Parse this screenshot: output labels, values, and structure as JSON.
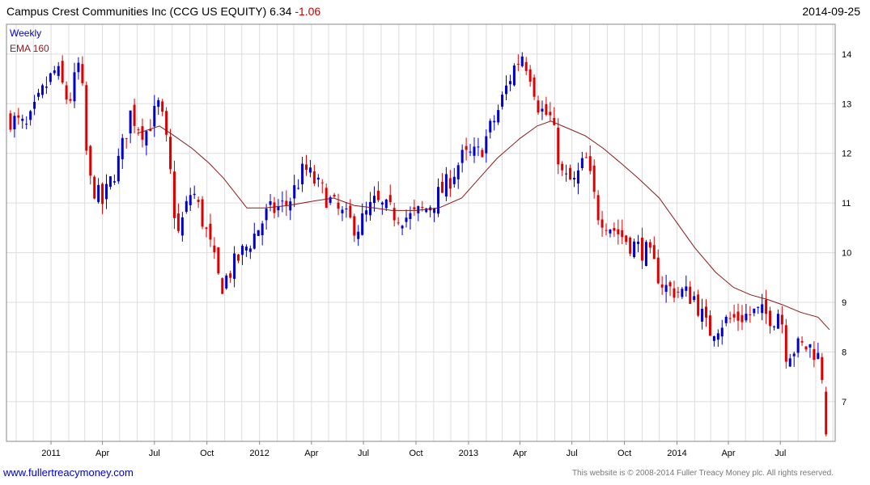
{
  "header": {
    "title": "Campus Crest Communities Inc (CCG US EQUITY) 6.34",
    "change": "-1.06",
    "date": "2014-09-25"
  },
  "footer": {
    "site": "www.fullertreacymoney.com",
    "copyright": "This website is © 2008-2014 Fuller Treacy Money plc. All rights reserved."
  },
  "chart_data": {
    "type": "candlestick",
    "title": "Campus Crest Communities Inc (CCG US EQUITY) 6.34 -1.06",
    "legend": [
      "Weekly",
      "EMA 160"
    ],
    "legend_position": "top-left",
    "y_axis_side": "right",
    "grid": true,
    "colors": {
      "up": "#0000cc",
      "down": "#dd0000",
      "ema": "#8b1a1a",
      "grid": "#dddddd"
    },
    "ylim": [
      6.2,
      14.6
    ],
    "yticks": [
      7,
      8,
      9,
      10,
      11,
      12,
      13,
      14
    ],
    "xticks": [
      {
        "label": "2011",
        "date": "2011-01-01"
      },
      {
        "label": "Apr",
        "date": "2011-04-01"
      },
      {
        "label": "Jul",
        "date": "2011-07-01"
      },
      {
        "label": "Oct",
        "date": "2011-10-01"
      },
      {
        "label": "2012",
        "date": "2012-01-01"
      },
      {
        "label": "Apr",
        "date": "2012-04-01"
      },
      {
        "label": "Jul",
        "date": "2012-07-01"
      },
      {
        "label": "Oct",
        "date": "2012-10-01"
      },
      {
        "label": "2013",
        "date": "2013-01-01"
      },
      {
        "label": "Apr",
        "date": "2013-04-01"
      },
      {
        "label": "Jul",
        "date": "2013-07-01"
      },
      {
        "label": "Oct",
        "date": "2013-10-01"
      },
      {
        "label": "2014",
        "date": "2014-01-01"
      },
      {
        "label": "Apr",
        "date": "2014-04-01"
      },
      {
        "label": "Jul",
        "date": "2014-07-01"
      }
    ],
    "xlim": [
      "2010-10-15",
      "2014-10-05"
    ],
    "close_path": [
      [
        "2010-10-22",
        12.7
      ],
      [
        "2010-11-20",
        12.5
      ],
      [
        "2010-12-20",
        13.3
      ],
      [
        "2011-01-10",
        13.7
      ],
      [
        "2011-02-01",
        13.0
      ],
      [
        "2011-02-21",
        13.9
      ],
      [
        "2011-03-07",
        11.5
      ],
      [
        "2011-04-01",
        11.0
      ],
      [
        "2011-05-01",
        11.9
      ],
      [
        "2011-05-20",
        12.8
      ],
      [
        "2011-06-15",
        12.4
      ],
      [
        "2011-07-10",
        13.0
      ],
      [
        "2011-07-25",
        12.0
      ],
      [
        "2011-08-10",
        10.3
      ],
      [
        "2011-09-05",
        11.3
      ],
      [
        "2011-10-03",
        10.3
      ],
      [
        "2011-10-25",
        9.3
      ],
      [
        "2011-11-20",
        9.8
      ],
      [
        "2011-12-20",
        10.3
      ],
      [
        "2012-01-15",
        10.8
      ],
      [
        "2012-02-20",
        11.0
      ],
      [
        "2012-03-20",
        11.7
      ],
      [
        "2012-04-15",
        11.3
      ],
      [
        "2012-05-20",
        10.8
      ],
      [
        "2012-06-20",
        10.5
      ],
      [
        "2012-07-20",
        11.0
      ],
      [
        "2012-08-20",
        10.8
      ],
      [
        "2012-09-20",
        10.7
      ],
      [
        "2012-10-20",
        10.9
      ],
      [
        "2012-11-20",
        11.3
      ],
      [
        "2012-12-20",
        11.9
      ],
      [
        "2013-01-20",
        12.0
      ],
      [
        "2013-02-20",
        12.8
      ],
      [
        "2013-03-20",
        13.7
      ],
      [
        "2013-04-05",
        14.0
      ],
      [
        "2013-04-20",
        13.6
      ],
      [
        "2013-05-05",
        12.9
      ],
      [
        "2013-05-25",
        12.7
      ],
      [
        "2013-06-15",
        11.5
      ],
      [
        "2013-07-05",
        11.4
      ],
      [
        "2013-07-25",
        11.9
      ],
      [
        "2013-08-15",
        10.8
      ],
      [
        "2013-09-10",
        10.5
      ],
      [
        "2013-10-10",
        10.2
      ],
      [
        "2013-11-10",
        10.0
      ],
      [
        "2013-12-10",
        9.3
      ],
      [
        "2014-01-10",
        9.2
      ],
      [
        "2014-02-01",
        9.1
      ],
      [
        "2014-02-25",
        8.4
      ],
      [
        "2014-03-20",
        8.6
      ],
      [
        "2014-04-20",
        8.7
      ],
      [
        "2014-05-20",
        8.8
      ],
      [
        "2014-06-20",
        8.7
      ],
      [
        "2014-07-01",
        8.9
      ],
      [
        "2014-07-10",
        8.0
      ],
      [
        "2014-08-01",
        8.1
      ],
      [
        "2014-08-25",
        8.1
      ],
      [
        "2014-09-05",
        7.9
      ],
      [
        "2014-09-15",
        7.4
      ],
      [
        "2014-09-25",
        6.34
      ]
    ],
    "ema_160": [
      [
        "2011-06-01",
        12.4
      ],
      [
        "2011-07-10",
        12.55
      ],
      [
        "2011-08-05",
        12.35
      ],
      [
        "2011-09-05",
        12.1
      ],
      [
        "2011-10-05",
        11.8
      ],
      [
        "2011-10-30",
        11.5
      ],
      [
        "2011-12-10",
        10.9
      ],
      [
        "2012-01-10",
        10.9
      ],
      [
        "2012-02-20",
        10.95
      ],
      [
        "2012-04-10",
        11.05
      ],
      [
        "2012-05-10",
        11.1
      ],
      [
        "2012-06-15",
        10.95
      ],
      [
        "2012-07-20",
        10.9
      ],
      [
        "2012-08-20",
        10.85
      ],
      [
        "2012-10-01",
        10.85
      ],
      [
        "2012-11-10",
        10.9
      ],
      [
        "2012-12-20",
        11.1
      ],
      [
        "2013-01-20",
        11.5
      ],
      [
        "2013-02-20",
        11.9
      ],
      [
        "2013-04-01",
        12.3
      ],
      [
        "2013-05-01",
        12.55
      ],
      [
        "2013-05-25",
        12.65
      ],
      [
        "2013-06-25",
        12.5
      ],
      [
        "2013-07-25",
        12.35
      ],
      [
        "2013-08-25",
        12.1
      ],
      [
        "2013-09-25",
        11.8
      ],
      [
        "2013-10-25",
        11.5
      ],
      [
        "2013-12-01",
        11.1
      ],
      [
        "2014-01-01",
        10.6
      ],
      [
        "2014-02-01",
        10.1
      ],
      [
        "2014-03-10",
        9.6
      ],
      [
        "2014-04-10",
        9.3
      ],
      [
        "2014-05-10",
        9.15
      ],
      [
        "2014-06-10",
        9.05
      ],
      [
        "2014-07-05",
        8.95
      ],
      [
        "2014-08-05",
        8.8
      ],
      [
        "2014-09-05",
        8.7
      ],
      [
        "2014-09-25",
        8.45
      ]
    ]
  }
}
